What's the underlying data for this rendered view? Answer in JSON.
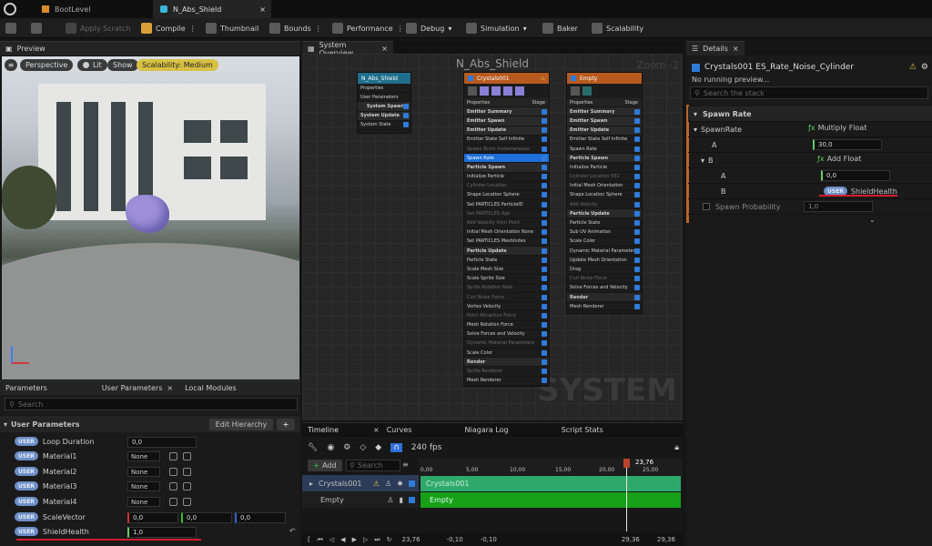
{
  "tabs": {
    "boot": "BootLevel",
    "niagara": "N_Abs_Shield"
  },
  "toolbar": {
    "apply_scratch": "Apply Scratch",
    "compile": "Compile",
    "thumbnail": "Thumbnail",
    "bounds": "Bounds",
    "performance": "Performance",
    "debug": "Debug",
    "simulation": "Simulation",
    "baker": "Baker",
    "scalability": "Scalability"
  },
  "preview": {
    "tab": "Preview",
    "perspective": "Perspective",
    "lit": "Lit",
    "show": "Show",
    "scalability": "Scalability: Medium"
  },
  "params": {
    "tab_params": "Parameters",
    "tab_user": "User Parameters",
    "tab_local": "Local Modules",
    "search_placeholder": "Search",
    "section": "User Parameters",
    "edit_hierarchy": "Edit Hierarchy",
    "plus": "+",
    "rows": [
      {
        "badge": "USER",
        "name": "Loop Duration",
        "value": "0,0"
      },
      {
        "badge": "USER",
        "name": "Material1",
        "value": "None"
      },
      {
        "badge": "USER",
        "name": "Material2",
        "value": "None"
      },
      {
        "badge": "USER",
        "name": "Material3",
        "value": "None"
      },
      {
        "badge": "USER",
        "name": "Material4",
        "value": "None"
      },
      {
        "badge": "USER",
        "name": "ScaleVector",
        "v1": "0,0",
        "v2": "0,0",
        "v3": "0,0"
      },
      {
        "badge": "USER",
        "name": "ShieldHealth",
        "value": "1,0"
      }
    ]
  },
  "overview": {
    "tab": "System Overview",
    "title": "N_Abs_Shield",
    "zoom": "Zoom -2",
    "watermark": "SYSTEM",
    "system_node": {
      "title": "N_Abs_Shield",
      "rows": [
        "Properties",
        "User Parameters",
        "System Spawn",
        "System Update",
        "System State"
      ]
    },
    "crystals_node": {
      "title": "Crystals001",
      "properties": "Properties",
      "stage": "Stage",
      "rows": [
        {
          "t": "Emitter Summary",
          "k": "sec"
        },
        {
          "t": "Emitter Spawn",
          "k": "sec"
        },
        {
          "t": "Emitter Update",
          "k": "sec"
        },
        {
          "t": "Emitter State  Self  Infinite",
          "k": ""
        },
        {
          "t": "Spawn Burst Instantaneous",
          "k": "dim"
        },
        {
          "t": "Spawn Rate",
          "k": "sel"
        },
        {
          "t": "Particle Spawn",
          "k": "sec"
        },
        {
          "t": "Initialize Particle",
          "k": ""
        },
        {
          "t": "Cylinder Location",
          "k": "dim"
        },
        {
          "t": "Shape Location  Sphere",
          "k": ""
        },
        {
          "t": "Set  PARTICLES  ParticleID",
          "k": ""
        },
        {
          "t": "Set  PARTICLES  Age",
          "k": "dim"
        },
        {
          "t": "Add Velocity from Point",
          "k": "dim"
        },
        {
          "t": "Initial Mesh Orientation  None",
          "k": ""
        },
        {
          "t": "Set  PARTICLES  MeshIndex",
          "k": ""
        },
        {
          "t": "Particle Update",
          "k": "sec"
        },
        {
          "t": "Particle State",
          "k": ""
        },
        {
          "t": "Scale Mesh Size",
          "k": ""
        },
        {
          "t": "Scale Sprite Size",
          "k": ""
        },
        {
          "t": "Sprite Rotation Rate",
          "k": "dim"
        },
        {
          "t": "Curl Noise Force",
          "k": "dim"
        },
        {
          "t": "Vortex Velocity",
          "k": ""
        },
        {
          "t": "Point Attraction Force",
          "k": "dim"
        },
        {
          "t": "Mesh Rotation Force",
          "k": ""
        },
        {
          "t": "Solve Forces and Velocity",
          "k": ""
        },
        {
          "t": "Dynamic Material Parameters",
          "k": "dim"
        },
        {
          "t": "Scale Color",
          "k": ""
        },
        {
          "t": "Render",
          "k": "sec"
        },
        {
          "t": "Sprite Renderer",
          "k": "dim"
        },
        {
          "t": "Mesh Renderer",
          "k": ""
        }
      ]
    },
    "empty_node": {
      "title": "Empty",
      "properties": "Properties",
      "stage": "Stage",
      "rows": [
        {
          "t": "Emitter Summary",
          "k": "sec"
        },
        {
          "t": "Emitter Spawn",
          "k": "sec"
        },
        {
          "t": "Emitter Update",
          "k": "sec"
        },
        {
          "t": "Emitter State  Self  Infinite",
          "k": ""
        },
        {
          "t": "Spawn Rate",
          "k": ""
        },
        {
          "t": "Particle Spawn",
          "k": "sec"
        },
        {
          "t": "Initialize Particle",
          "k": ""
        },
        {
          "t": "Cylinder Location 001",
          "k": "dim"
        },
        {
          "t": "Initial Mesh Orientation",
          "k": ""
        },
        {
          "t": "Shape Location  Sphere",
          "k": ""
        },
        {
          "t": "Add Velocity",
          "k": "dim"
        },
        {
          "t": "Particle Update",
          "k": "sec"
        },
        {
          "t": "Particle State",
          "k": ""
        },
        {
          "t": "Sub UV Animation",
          "k": ""
        },
        {
          "t": "Scale Color",
          "k": ""
        },
        {
          "t": "Dynamic Material Parameters",
          "k": ""
        },
        {
          "t": "Update Mesh Orientation",
          "k": ""
        },
        {
          "t": "Drag",
          "k": ""
        },
        {
          "t": "Curl Noise Force",
          "k": "dim"
        },
        {
          "t": "Solve Forces and Velocity",
          "k": ""
        },
        {
          "t": "Render",
          "k": "sec"
        },
        {
          "t": "Mesh Renderer",
          "k": ""
        }
      ]
    }
  },
  "timeline": {
    "tab": "Timeline",
    "curves": "Curves",
    "log": "Niagara Log",
    "stats": "Script Stats",
    "add": "Add",
    "search": "Search",
    "fps": "240 fps",
    "current": "23,76",
    "ticks": [
      "0,00",
      "5,00",
      "10,00",
      "15,00",
      "20,00",
      "25,00"
    ],
    "tracks": [
      {
        "name": "Crystals001",
        "bar": "Crystals001"
      },
      {
        "name": "Empty",
        "bar": "Empty"
      }
    ],
    "footer": {
      "time": "23,76",
      "a": "-0,10",
      "b": "-0,10",
      "c": "29,36",
      "d": "29,36"
    },
    "progress": 0.79
  },
  "details": {
    "tab": "Details",
    "title": "Crystals001 ES_Rate_Noise_Cylinder",
    "no_preview": "No running preview...",
    "search": "Search the stack",
    "section": "Spawn Rate",
    "spawnrate": "SpawnRate",
    "multiply": "Multiply Float",
    "a": "A",
    "a_val": "30,0",
    "b": "B",
    "add": "Add Float",
    "a2": "A",
    "a2_val": "0,0",
    "b2": "B",
    "user": "USER",
    "shield": "ShieldHealth",
    "prob": "Spawn Probability",
    "prob_val": "1,0"
  }
}
